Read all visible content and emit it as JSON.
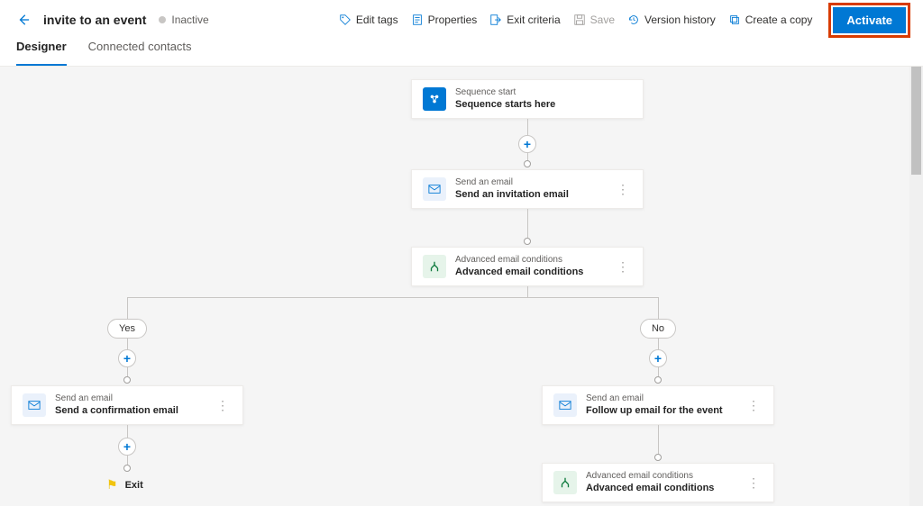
{
  "header": {
    "title": "invite to an event",
    "status": "Inactive"
  },
  "toolbar": {
    "edit_tags": "Edit tags",
    "properties": "Properties",
    "exit_criteria": "Exit criteria",
    "save": "Save",
    "version_history": "Version history",
    "create_copy": "Create a copy",
    "activate": "Activate"
  },
  "tabs": {
    "designer": "Designer",
    "connected_contacts": "Connected contacts"
  },
  "nodes": {
    "start": {
      "type": "Sequence start",
      "title": "Sequence starts here"
    },
    "email1": {
      "type": "Send an email",
      "title": "Send an invitation email"
    },
    "cond1": {
      "type": "Advanced email conditions",
      "title": "Advanced email conditions"
    },
    "yes_email": {
      "type": "Send an email",
      "title": "Send a confirmation email"
    },
    "no_email": {
      "type": "Send an email",
      "title": "Follow up email for the event"
    },
    "no_cond": {
      "type": "Advanced email conditions",
      "title": "Advanced email conditions"
    },
    "exit": {
      "title": "Exit"
    }
  },
  "branches": {
    "yes": "Yes",
    "no": "No"
  }
}
